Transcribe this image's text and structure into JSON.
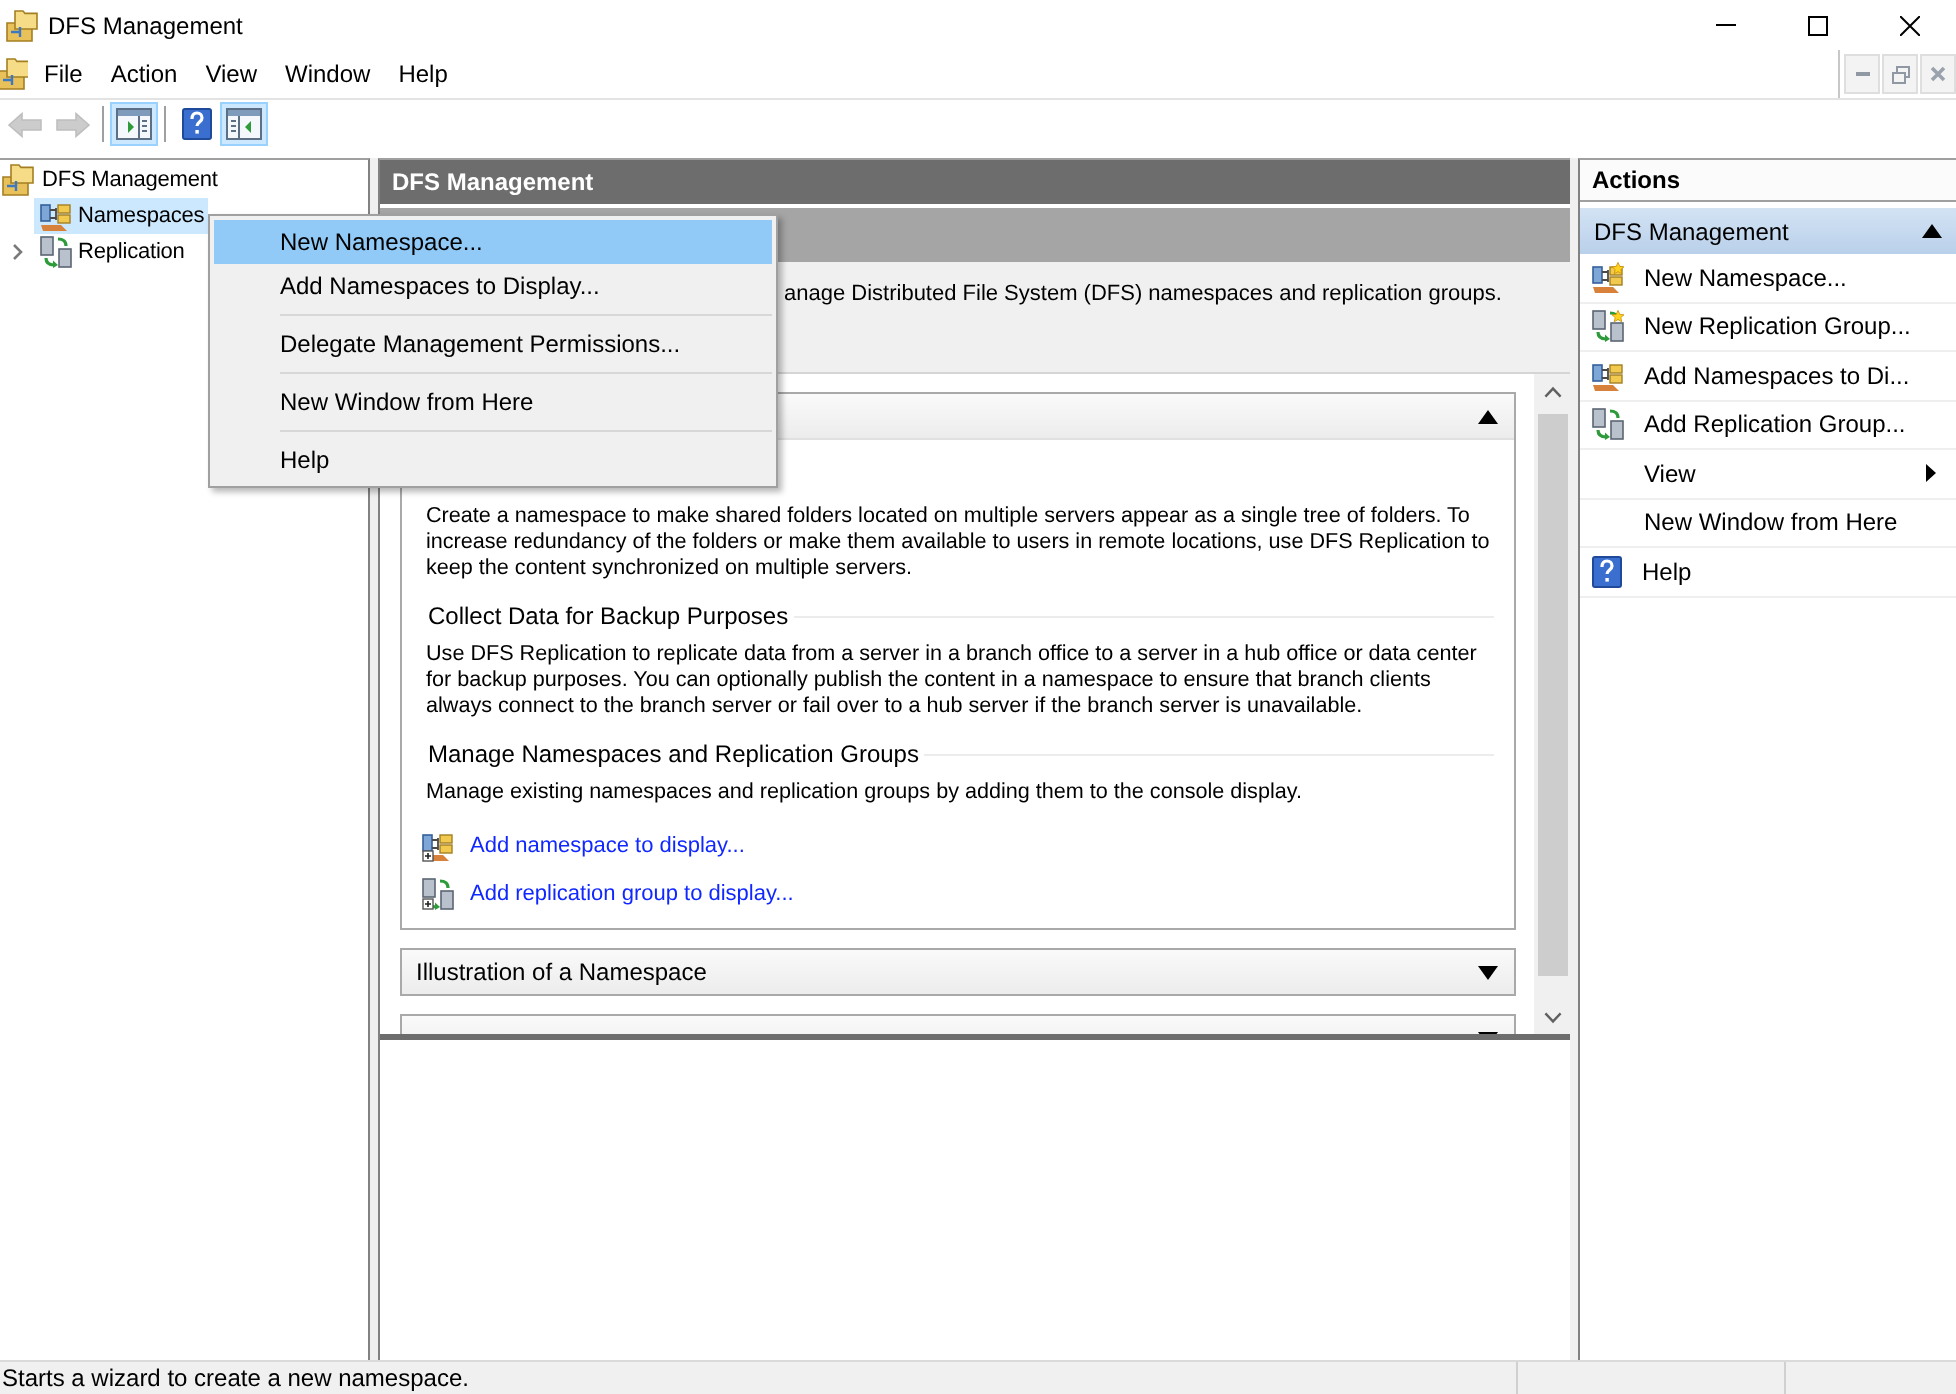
{
  "window": {
    "title": "DFS Management"
  },
  "menu_bar": {
    "items": [
      "File",
      "Action",
      "View",
      "Window",
      "Help"
    ]
  },
  "toolbar": {
    "groups": [
      [
        {
          "kind": "back",
          "pressed": false,
          "disabled": true
        },
        {
          "kind": "forward",
          "pressed": false,
          "disabled": true
        }
      ],
      [
        {
          "kind": "treepane",
          "pressed": true,
          "disabled": false
        }
      ],
      [
        {
          "kind": "help",
          "pressed": false,
          "disabled": false
        },
        {
          "kind": "actionpane",
          "pressed": true,
          "disabled": false
        }
      ]
    ]
  },
  "tree": {
    "root": {
      "kind": "dfs",
      "label": "DFS Management",
      "selected": false,
      "children": [
        {
          "kind": "namespaces",
          "label": "Namespaces",
          "selected": true
        },
        {
          "kind": "replication",
          "label": "Replication",
          "selected": false,
          "expanded": false
        }
      ]
    }
  },
  "context_menu": {
    "groups": [
      [
        {
          "label": "New Namespace...",
          "selected": true
        },
        {
          "label": "Add Namespaces to Display...",
          "selected": false
        }
      ],
      [
        {
          "label": "Delegate Management Permissions...",
          "selected": false
        }
      ],
      [
        {
          "label": "New Window from Here",
          "selected": false
        }
      ],
      [
        {
          "label": "Help",
          "selected": false
        }
      ]
    ]
  },
  "center_pane": {
    "title": "DFS Management",
    "description": "anage Distributed File System (DFS) namespaces and replication groups.",
    "sections": [
      {
        "expanded": true,
        "blocks": [
          {
            "kind": "paragraph",
            "text": "Create a namespace to make shared folders located on multiple servers appear as a single tree of folders. To increase redundancy of the folders or make them available to users in remote locations, use DFS Replication to keep the content synchronized on multiple servers."
          },
          {
            "kind": "heading",
            "text": "Collect Data for Backup Purposes"
          },
          {
            "kind": "paragraph",
            "text": "Use DFS Replication to replicate data from a server in a branch office to a server in a hub office or data center for backup purposes. You can optionally publish the content in a namespace to ensure that branch clients always connect to the branch server or fail over to a hub server if the branch server is unavailable."
          },
          {
            "kind": "heading",
            "text": "Manage Namespaces and Replication Groups"
          },
          {
            "kind": "paragraph",
            "text": "Manage existing namespaces and replication groups by adding them to the console display."
          },
          {
            "kind": "namespacelink",
            "text": "Add namespace to display..."
          },
          {
            "kind": "replicationlink",
            "text": "Add replication group to display..."
          }
        ]
      },
      {
        "title": "Illustration of a Namespace",
        "expanded": false
      },
      {
        "expanded": false
      }
    ]
  },
  "actions_pane": {
    "title": "Actions",
    "group": {
      "title": "DFS Management",
      "expanded": true,
      "items": [
        {
          "kind": "newnamespace",
          "label": "New Namespace..."
        },
        {
          "kind": "newreplication",
          "label": "New Replication Group..."
        },
        {
          "kind": "addnamespace",
          "label": "Add Namespaces to Di..."
        },
        {
          "kind": "addreplication",
          "label": "Add Replication Group..."
        },
        {
          "kind": "submenu",
          "label": "View"
        },
        {
          "kind": "plain",
          "label": "New Window from Here"
        },
        {
          "kind": "help",
          "label": "Help"
        }
      ]
    }
  },
  "status_bar": {
    "text": "Starts a wizard to create a new namespace."
  }
}
